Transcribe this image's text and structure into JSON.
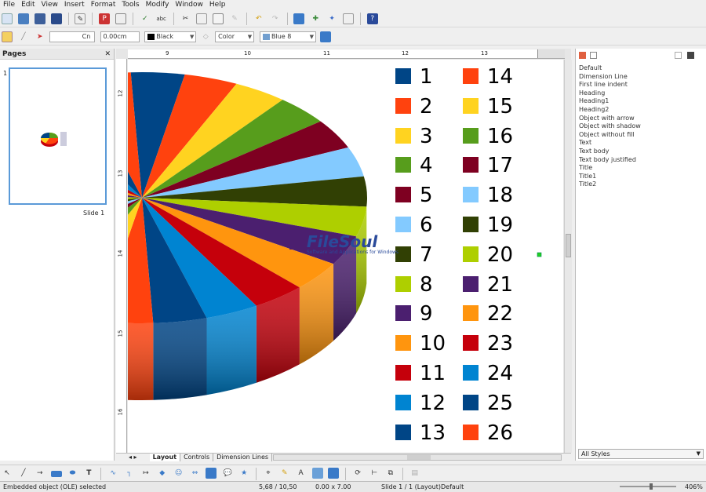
{
  "menu": [
    "File",
    "Edit",
    "View",
    "Insert",
    "Format",
    "Tools",
    "Modify",
    "Window",
    "Help"
  ],
  "toolbar2": {
    "line_style": "Cn",
    "line_width": "0.00cm",
    "line_color": "Black",
    "area_style": "Color",
    "area_color": "Blue 8"
  },
  "pages_panel": {
    "title": "Pages",
    "slide_number": "1",
    "slide_label": "Slide 1"
  },
  "ruler": {
    "top": [
      "9",
      "10",
      "11",
      "12",
      "13"
    ],
    "left": [
      "12",
      "13",
      "14",
      "15",
      "16"
    ]
  },
  "legend": [
    {
      "label": "1",
      "color": "#004586"
    },
    {
      "label": "2",
      "color": "#ff420e"
    },
    {
      "label": "3",
      "color": "#ffd320"
    },
    {
      "label": "4",
      "color": "#579d1c"
    },
    {
      "label": "5",
      "color": "#7e0021"
    },
    {
      "label": "6",
      "color": "#83caff"
    },
    {
      "label": "7",
      "color": "#314004"
    },
    {
      "label": "8",
      "color": "#aecf00"
    },
    {
      "label": "9",
      "color": "#4b1f6f"
    },
    {
      "label": "10",
      "color": "#ff950e"
    },
    {
      "label": "11",
      "color": "#c5000b"
    },
    {
      "label": "12",
      "color": "#0084d1"
    },
    {
      "label": "13",
      "color": "#004586"
    },
    {
      "label": "14",
      "color": "#ff420e"
    },
    {
      "label": "15",
      "color": "#ffd320"
    },
    {
      "label": "16",
      "color": "#579d1c"
    },
    {
      "label": "17",
      "color": "#7e0021"
    },
    {
      "label": "18",
      "color": "#83caff"
    },
    {
      "label": "19",
      "color": "#314004"
    },
    {
      "label": "20",
      "color": "#aecf00"
    },
    {
      "label": "21",
      "color": "#4b1f6f"
    },
    {
      "label": "22",
      "color": "#ff950e"
    },
    {
      "label": "23",
      "color": "#c5000b"
    },
    {
      "label": "24",
      "color": "#0084d1"
    },
    {
      "label": "25",
      "color": "#004586"
    },
    {
      "label": "26",
      "color": "#ff420e"
    }
  ],
  "watermark": {
    "brand": "FileSoul",
    "tagline": "Software and Applications for Windows"
  },
  "tabs": [
    "Layout",
    "Controls",
    "Dimension Lines"
  ],
  "styles": [
    "Default",
    "Dimension Line",
    "First line indent",
    "Heading",
    "Heading1",
    "Heading2",
    "Object with arrow",
    "Object with shadow",
    "Object without fill",
    "Text",
    "Text body",
    "Text body justified",
    "Title",
    "Title1",
    "Title2"
  ],
  "styles_filter": "All Styles",
  "status": {
    "selection": "Embedded object (OLE) selected",
    "position": "5,68 / 10,50",
    "size": "0.00 x 7.00",
    "slide": "Slide 1 / 1 (Layout)",
    "layout": "Default",
    "zoom": "406%"
  }
}
